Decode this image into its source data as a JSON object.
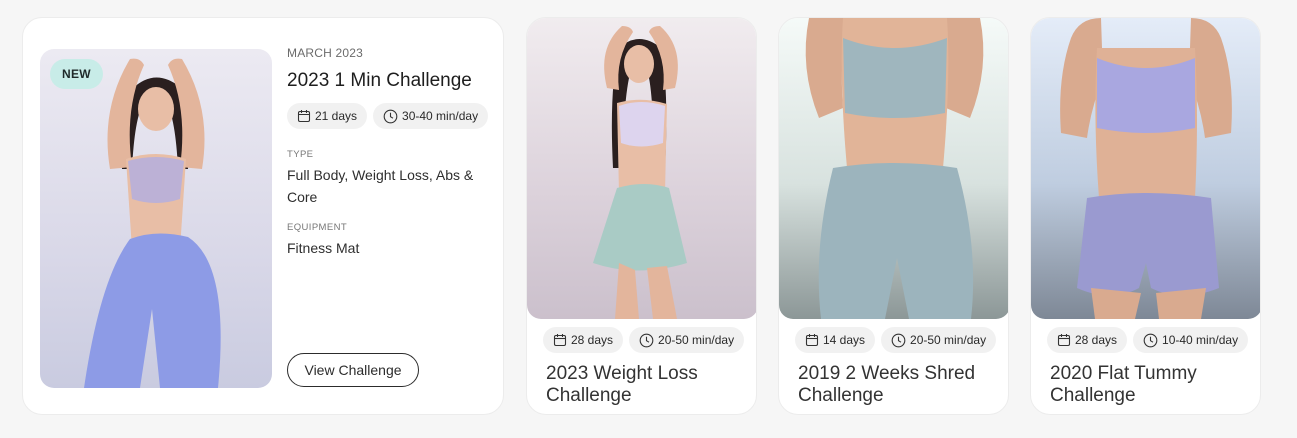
{
  "featured": {
    "badge": "NEW",
    "date": "MARCH 2023",
    "title": "2023 1 Min Challenge",
    "days": "21 days",
    "duration": "30-40 min/day",
    "type_label": "TYPE",
    "type_value": "Full Body, Weight Loss, Abs & Core",
    "equipment_label": "EQUIPMENT",
    "equipment_value": "Fitness Mat",
    "button_label": "View Challenge"
  },
  "challenges": [
    {
      "days": "28 days",
      "duration": "20-50 min/day",
      "title": "2023 Weight Loss Challenge"
    },
    {
      "days": "14 days",
      "duration": "20-50 min/day",
      "title": "2019 2 Weeks Shred Challenge"
    },
    {
      "days": "28 days",
      "duration": "10-40 min/day",
      "title": "2020 Flat Tummy Challenge"
    }
  ],
  "colors": {
    "badge_bg": "#c8ece8",
    "chip_bg": "#f1f1f1",
    "card_bg": "#ffffff",
    "page_bg": "#f6f6f6"
  },
  "icons": {
    "days": "calendar-icon",
    "duration": "clock-icon"
  }
}
